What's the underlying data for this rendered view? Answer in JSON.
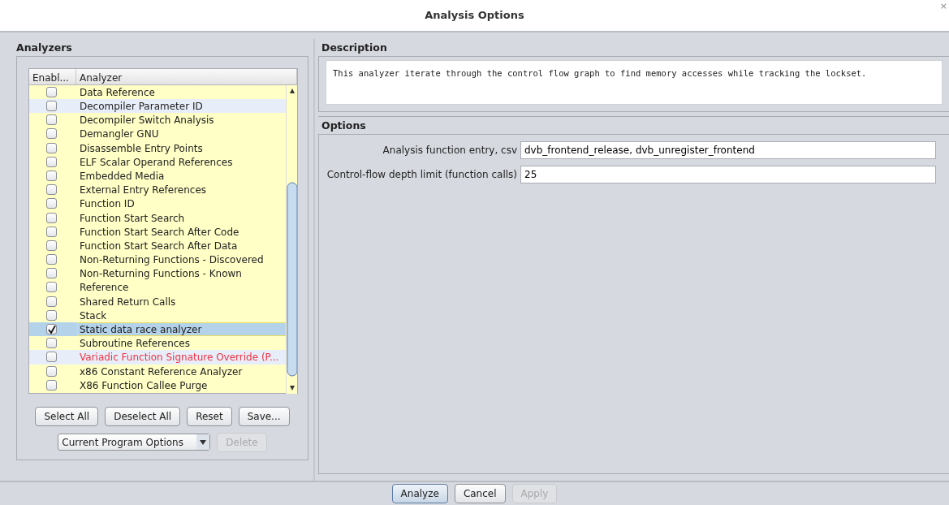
{
  "window": {
    "title": "Analysis Options",
    "close": "×"
  },
  "analyzers": {
    "title": "Analyzers",
    "columns": [
      "Enabl...",
      "Analyzer"
    ],
    "rows": [
      {
        "name": "Data Reference",
        "checked": false,
        "selected": false,
        "highlighted": false,
        "color": "#222222"
      },
      {
        "name": "Decompiler Parameter ID",
        "checked": false,
        "selected": false,
        "highlighted": true,
        "color": "#222222"
      },
      {
        "name": "Decompiler Switch Analysis",
        "checked": false,
        "selected": false,
        "highlighted": false,
        "color": "#222222"
      },
      {
        "name": "Demangler GNU",
        "checked": false,
        "selected": false,
        "highlighted": false,
        "color": "#222222"
      },
      {
        "name": "Disassemble Entry Points",
        "checked": false,
        "selected": false,
        "highlighted": false,
        "color": "#222222"
      },
      {
        "name": "ELF Scalar Operand References",
        "checked": false,
        "selected": false,
        "highlighted": false,
        "color": "#222222"
      },
      {
        "name": "Embedded Media",
        "checked": false,
        "selected": false,
        "highlighted": false,
        "color": "#222222"
      },
      {
        "name": "External Entry References",
        "checked": false,
        "selected": false,
        "highlighted": false,
        "color": "#222222"
      },
      {
        "name": "Function ID",
        "checked": false,
        "selected": false,
        "highlighted": false,
        "color": "#222222"
      },
      {
        "name": "Function Start Search",
        "checked": false,
        "selected": false,
        "highlighted": false,
        "color": "#222222"
      },
      {
        "name": "Function Start Search After Code",
        "checked": false,
        "selected": false,
        "highlighted": false,
        "color": "#222222"
      },
      {
        "name": "Function Start Search After Data",
        "checked": false,
        "selected": false,
        "highlighted": false,
        "color": "#222222"
      },
      {
        "name": "Non-Returning Functions - Discovered",
        "checked": false,
        "selected": false,
        "highlighted": false,
        "color": "#222222"
      },
      {
        "name": "Non-Returning Functions - Known",
        "checked": false,
        "selected": false,
        "highlighted": false,
        "color": "#222222"
      },
      {
        "name": "Reference",
        "checked": false,
        "selected": false,
        "highlighted": false,
        "color": "#222222"
      },
      {
        "name": "Shared Return Calls",
        "checked": false,
        "selected": false,
        "highlighted": false,
        "color": "#222222"
      },
      {
        "name": "Stack",
        "checked": false,
        "selected": false,
        "highlighted": false,
        "color": "#222222"
      },
      {
        "name": "Static data race analyzer",
        "checked": true,
        "selected": true,
        "highlighted": false,
        "color": "#222222"
      },
      {
        "name": "Subroutine References",
        "checked": false,
        "selected": false,
        "highlighted": false,
        "color": "#222222"
      },
      {
        "name": "Variadic Function Signature Override (P...",
        "checked": false,
        "selected": false,
        "highlighted": true,
        "color": "#ee3344"
      },
      {
        "name": "x86 Constant Reference Analyzer",
        "checked": false,
        "selected": false,
        "highlighted": false,
        "color": "#222222"
      },
      {
        "name": "X86 Function Callee Purge",
        "checked": false,
        "selected": false,
        "highlighted": false,
        "color": "#222222"
      }
    ],
    "buttons": [
      "Select All",
      "Deselect All",
      "Reset",
      "Save..."
    ],
    "profile": {
      "value": "Current Program Options"
    },
    "delete": {
      "label": "Delete",
      "disabled": true
    }
  },
  "description": {
    "title": "Description",
    "text": "This analyzer iterate through the control flow graph to find memory accesses while tracking the lockset."
  },
  "options": {
    "title": "Options",
    "fields": [
      {
        "label": "Analysis function entry, csv",
        "value": "dvb_frontend_release, dvb_unregister_frontend"
      },
      {
        "label": "Control-flow depth limit (function calls)",
        "value": "25"
      }
    ]
  },
  "footer": [
    {
      "label": "Analyze",
      "disabled": false,
      "default": true
    },
    {
      "label": "Cancel",
      "disabled": false,
      "default": false
    },
    {
      "label": "Apply",
      "disabled": true,
      "default": false
    }
  ]
}
